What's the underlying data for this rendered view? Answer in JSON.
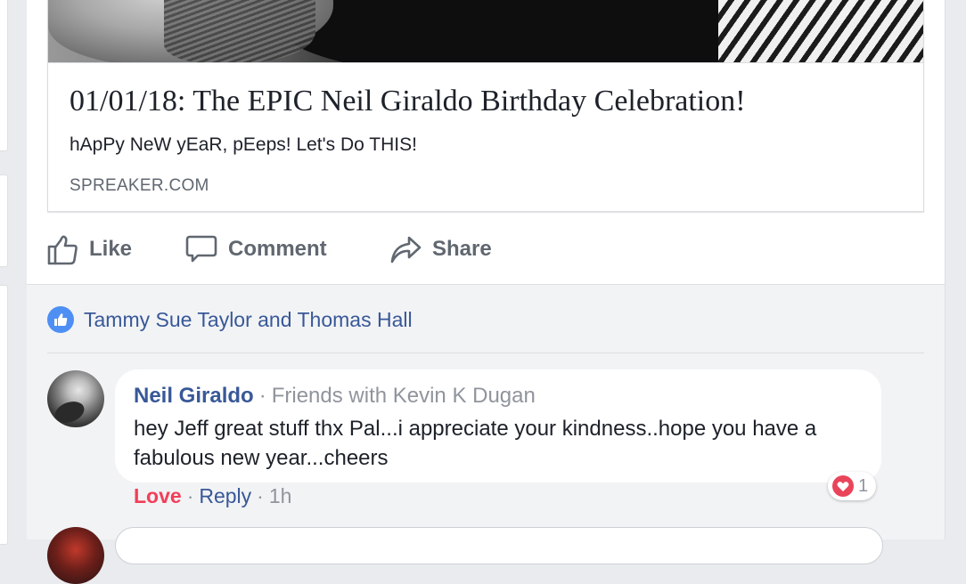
{
  "link_preview": {
    "title": "01/01/18: The EPIC Neil Giraldo Birthday Celebration!",
    "description": "hApPy NeW yEaR, pEeps! Let's Do THIS!",
    "domain": "SPREAKER.COM"
  },
  "actions": {
    "like": "Like",
    "comment": "Comment",
    "share": "Share"
  },
  "reactions": {
    "likers": "Tammy Sue Taylor and Thomas Hall"
  },
  "comment": {
    "author": "Neil Giraldo",
    "separator": "·",
    "context": "Friends with Kevin K Dugan",
    "text": "hey Jeff great stuff thx Pal...i appreciate your kindness..hope you have a fabulous new year...cheers",
    "reaction_count": "1",
    "love_label": "Love",
    "reply_label": "Reply",
    "time": "1h"
  },
  "colors": {
    "link_blue": "#385898",
    "muted_gray": "#606770",
    "love_red": "#f33e58",
    "like_blue": "#4e8ff4"
  },
  "icons": [
    "thumbs-up-icon",
    "comment-icon",
    "share-icon",
    "like-badge-icon",
    "heart-icon"
  ]
}
